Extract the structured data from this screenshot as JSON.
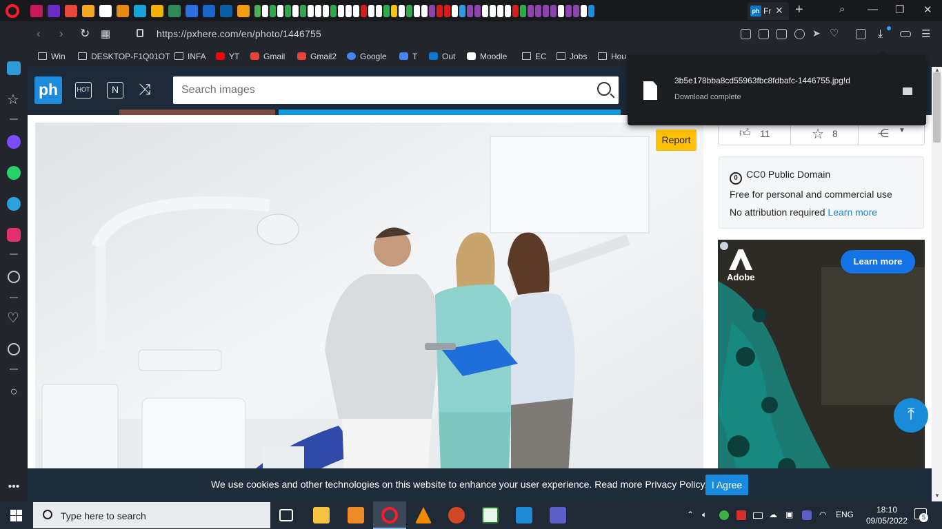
{
  "browser": {
    "active_tab": {
      "title": "Fr",
      "favicon_text": "ph"
    },
    "url": "https://pxhere.com/en/photo/1446755",
    "bookmarks": [
      {
        "label": "Win",
        "icon": "folder-icon"
      },
      {
        "label": "DESKTOP-F1Q01OT",
        "icon": "folder-icon"
      },
      {
        "label": "INFA",
        "icon": "folder-icon"
      },
      {
        "label": "YT",
        "icon": "youtube-icon",
        "color": "#ff0000"
      },
      {
        "label": "Gmail",
        "icon": "gmail-icon",
        "color": "#ea4335"
      },
      {
        "label": "Gmail2",
        "icon": "gmail-icon",
        "color": "#ea4335"
      },
      {
        "label": "Google",
        "icon": "google-icon",
        "color": "#4285f4"
      },
      {
        "label": "T",
        "icon": "translate-icon",
        "color": "#4285f4"
      },
      {
        "label": "Out",
        "icon": "outlook-icon",
        "color": "#0f78d4"
      },
      {
        "label": "Moodle",
        "icon": "moodle-icon",
        "color": "#ffffff"
      },
      {
        "label": "EC",
        "icon": "folder-icon"
      },
      {
        "label": "Jobs",
        "icon": "folder-icon"
      },
      {
        "label": "Hou",
        "icon": "folder-icon"
      }
    ],
    "download_popup": {
      "filename": "3b5e178bba8cd55963fbc8fdbafc-1446755.jpg!d",
      "status": "Download complete"
    }
  },
  "site": {
    "logo_text": "ph",
    "hot_label": "HOT",
    "new_label": "N",
    "search_placeholder": "Search images",
    "report_label": "Report",
    "likes": "11",
    "favorites": "8",
    "license": {
      "title": "CC0 Public Domain",
      "cc0_badge": "0",
      "line1": "Free for personal and commercial use",
      "line2": "No attribution required",
      "learn_more": "Learn more"
    },
    "ad": {
      "brand": "Adobe",
      "cta": "Learn more"
    },
    "cookie": {
      "text": "We use cookies and other technologies on this website to enhance your user experience. Read more Privacy Policy.",
      "agree_label": "I Agree"
    }
  },
  "taskbar": {
    "search_placeholder": "Type here to search",
    "language": "ENG",
    "time": "18:10",
    "date": "09/05/2022",
    "notification_count": "5"
  },
  "colors": {
    "opera_red": "#ff1b2d",
    "pxhere_blue": "#1e8cdc",
    "report_yellow": "#ffc107",
    "adobe_blue": "#1473e6"
  }
}
